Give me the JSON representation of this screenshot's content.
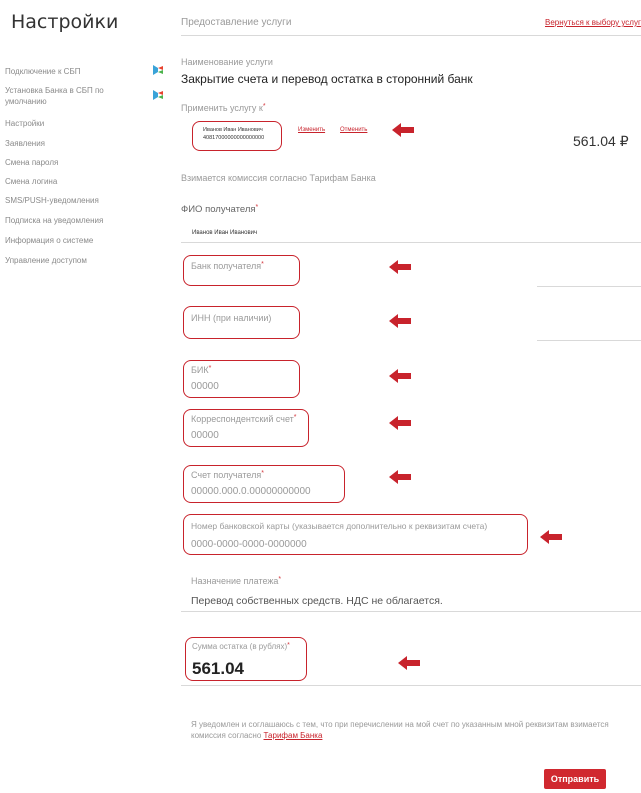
{
  "sidebar": {
    "title": "Настройки",
    "items": [
      {
        "label": "Подключение к СБП"
      },
      {
        "label": "Установка Банка в СБП по умолчанию"
      },
      {
        "label": "Настройки"
      },
      {
        "label": "Заявления"
      },
      {
        "label": "Смена пароля"
      },
      {
        "label": "Смена логина"
      },
      {
        "label": "SMS/PUSH-уведомления"
      },
      {
        "label": "Подписка на уведомления"
      },
      {
        "label": "Информация о системе"
      },
      {
        "label": "Управление доступом"
      }
    ]
  },
  "header": {
    "section": "Предоставление услуги",
    "back_link": "Вернуться к выбору услуг"
  },
  "service": {
    "name_label": "Наименование услуги",
    "name_value": "Закрытие счета и перевод остатка в сторонний банк",
    "apply_label": "Применить услугу к",
    "account_owner": "Иванов Иван Иванович",
    "account_number": "40817000000000000000",
    "change_link": "Изменить",
    "cancel_link": "Отменить",
    "balance": "561.04 ₽",
    "commission_note": "Взимается комиссия согласно Тарифам Банка"
  },
  "form": {
    "fio_label": "ФИО получателя",
    "fio_value": "Иванов Иван Иванович",
    "bank_label": "Банк получателя",
    "inn_label": "ИНН (при наличии)",
    "bik_label": "БИК",
    "bik_placeholder": "00000",
    "corr_label": "Корреспондентский счет",
    "corr_placeholder": "00000",
    "account_label": "Счет получателя",
    "account_placeholder": "00000.000.0.00000000000",
    "card_label": "Номер банковской карты (указывается дополнительно к реквизитам счета)",
    "card_placeholder": "0000-0000-0000-0000000",
    "purpose_label": "Назначение платежа",
    "purpose_value": "Перевод собственных средств. НДС не облагается.",
    "amount_label": "Сумма остатка (в рублях)",
    "amount_value": "561.04"
  },
  "footer": {
    "agreement_text": "Я уведомлен и соглашаюсь с тем, что при перечислении на мой счет по указанным мной реквизитам взимается комиссия согласно",
    "agreement_link": "Тарифам Банка",
    "submit_label": "Отправить"
  },
  "colors": {
    "accent": "#c8232c",
    "button": "#d0282f"
  }
}
